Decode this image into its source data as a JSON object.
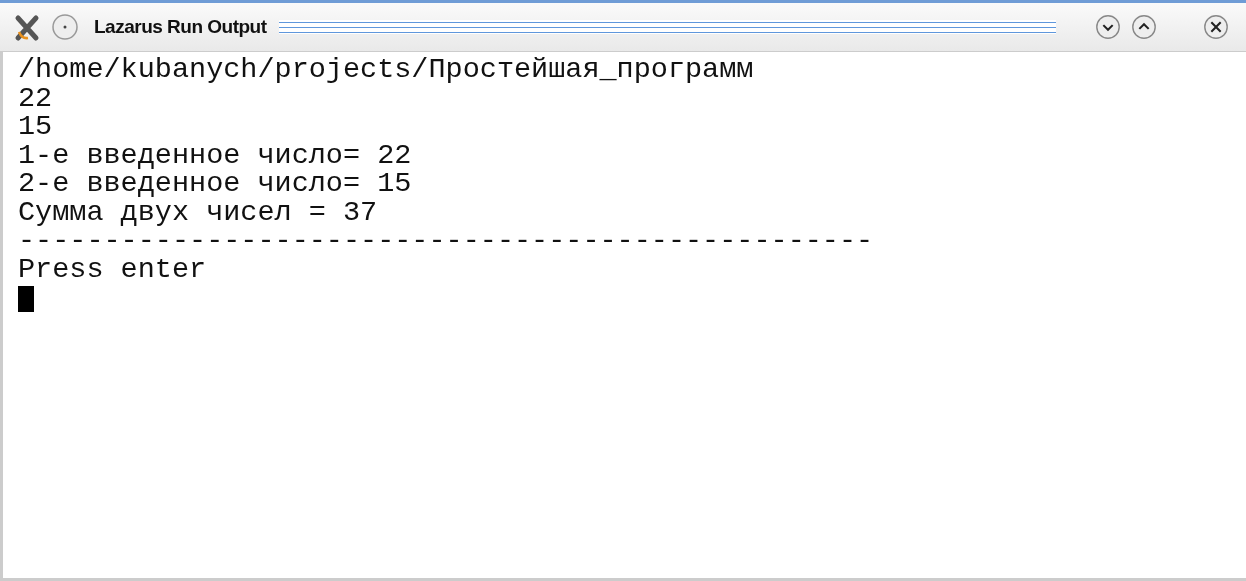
{
  "window": {
    "title": "Lazarus Run Output"
  },
  "console": {
    "lines": [
      "/home/kubanych/projects/Простейшая_программ",
      "22",
      "15",
      "1-е введенное число= 22",
      "2-е введенное число= 15",
      "Сумма двух чисел = 37",
      "--------------------------------------------------",
      "Press enter"
    ],
    "cursor": true
  }
}
